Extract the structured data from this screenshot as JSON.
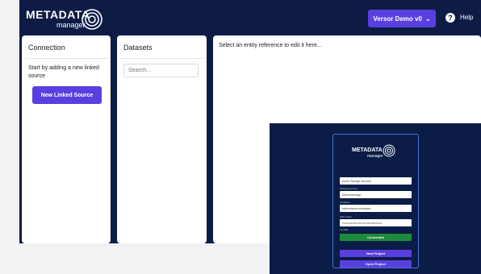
{
  "app": {
    "logo_text": "METADATA",
    "logo_sub": "manager",
    "env_button": "Versor Demo v0",
    "help_label": "Help"
  },
  "connection": {
    "title": "Connection",
    "text": "Start by adding a new linked source",
    "button": "New Linked Source"
  },
  "datasets": {
    "title": "Datasets",
    "search_placeholder": "Search..."
  },
  "editor": {
    "placeholder": "Select an entity reference to edit it here..."
  },
  "login": {
    "logo_text": "METADATA",
    "logo_sub": "manager",
    "auth_value": "Azure Storage Account",
    "storage_label": "Storage Account",
    "storage_value": "labrhovstorage",
    "container_label": "Container",
    "container_value": "labrhovstore-metadata",
    "sas_label": "SAS Token",
    "sas_value": "••••••••••••••••••••••••••••••••••••••••",
    "sas_hint": "no valid",
    "connect_button": "Connected",
    "new_project": "New Project",
    "open_project": "Open Project"
  }
}
